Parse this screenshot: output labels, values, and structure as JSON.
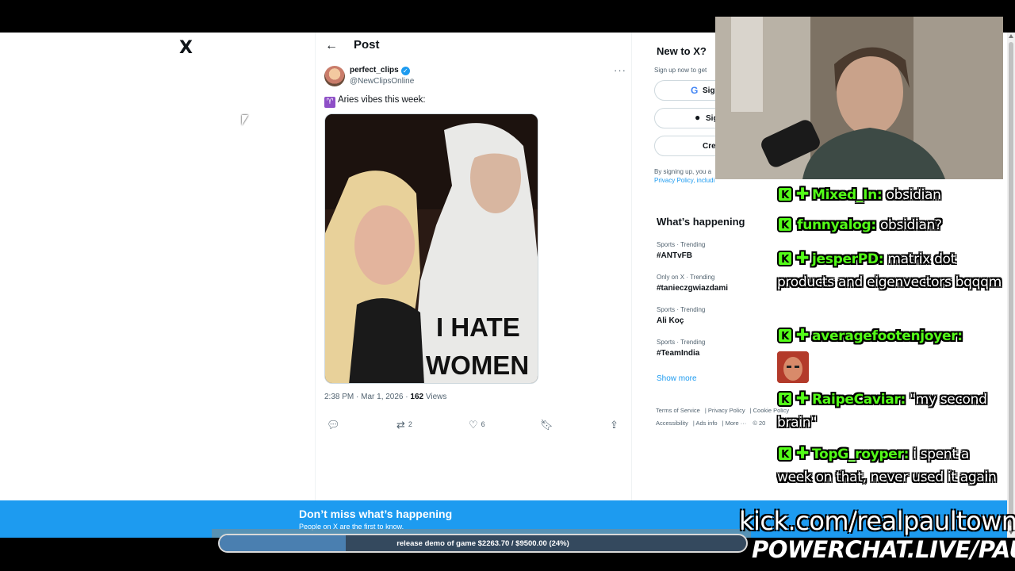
{
  "x_logo": "X",
  "post_header": {
    "title": "Post"
  },
  "post": {
    "author_name": "perfect_clips",
    "author_handle": "@NewClipsOnline",
    "text": "Aries vibes this week:",
    "shirt_text_line1": "I HATE",
    "shirt_text_line2": "WOMEN",
    "timestamp": "2:38 PM · Mar 1, 2026 · ",
    "views_count": "162",
    "views_label": " Views",
    "retweets": "2",
    "likes": "6"
  },
  "signup": {
    "title": "New to X?",
    "subtitle": "Sign up now to get",
    "google_label": "Sig",
    "apple_label": "Sig",
    "create_label": "Cre",
    "legal_text": "By signing up, you a",
    "legal_links": "Privacy Policy, includi"
  },
  "trending": {
    "title": "What’s happening",
    "items": [
      {
        "meta": "Sports · Trending",
        "tag": "#ANTvFB"
      },
      {
        "meta": "Only on X · Trending",
        "tag": "#tanieczgwiazdami"
      },
      {
        "meta": "Sports · Trending",
        "tag": "Ali Koç"
      },
      {
        "meta": "Sports · Trending",
        "tag": "#TeamIndia"
      }
    ],
    "show_more": "Show more"
  },
  "footer": {
    "terms": "Terms of Service",
    "privacy": "Privacy Policy",
    "cookie": "Cookie Policy",
    "accessibility": "Accessibility",
    "ads": "Ads info",
    "more": "More ···",
    "copyright": "© 20"
  },
  "banner": {
    "title": "Don’t miss what’s happening",
    "subtitle": "People on X are the first to know."
  },
  "chat": [
    {
      "user": "Mixed_In:",
      "message": "obsidian",
      "plus": true
    },
    {
      "user": "funnyalog:",
      "message": "obsidian?",
      "plus": false
    },
    {
      "user": "jesperPD:",
      "message": "matrix dot products and eigenvectors bqqqm",
      "plus": true
    },
    {
      "user": "averagefootenjoyer:",
      "message": "",
      "plus": true,
      "emote": "leo-emote"
    },
    {
      "user": "RaipeCaviar:",
      "message": "\"my second brain\"",
      "plus": true
    },
    {
      "user": "TopG_royper:",
      "message": "i spent a week on that, never used it again",
      "plus": true
    }
  ],
  "overlay": {
    "kick_url": "kick.com/realpaultown",
    "powerchat": "POWERCHAT.LIVE/PAULTOWN"
  },
  "donation_goal": {
    "label": "release demo of game $2263.70 / $9500.00 (24%)",
    "progress": 0.24,
    "fill_color": "#4a7fb0"
  },
  "colors": {
    "accent": "#1d9bf0",
    "kick_green": "#53fc18"
  }
}
